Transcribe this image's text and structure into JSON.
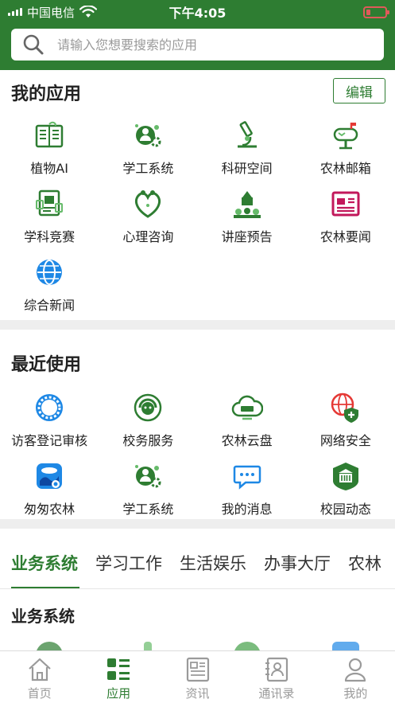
{
  "status_bar": {
    "carrier": "中国电信",
    "time": "下午4:05"
  },
  "search": {
    "placeholder": "请输入您想要搜索的应用"
  },
  "my_apps": {
    "title": "我的应用",
    "edit_label": "编辑",
    "items": [
      {
        "label": "植物AI",
        "icon": "plant-book-icon"
      },
      {
        "label": "学工系统",
        "icon": "student-gear-icon"
      },
      {
        "label": "科研空间",
        "icon": "microscope-icon"
      },
      {
        "label": "农林邮箱",
        "icon": "mailbox-icon"
      },
      {
        "label": "学科竞赛",
        "icon": "competition-icon"
      },
      {
        "label": "心理咨询",
        "icon": "heart-people-icon"
      },
      {
        "label": "讲座预告",
        "icon": "lecture-icon"
      },
      {
        "label": "农林要闻",
        "icon": "newspaper-icon"
      },
      {
        "label": "综合新闻",
        "icon": "globe-icon"
      }
    ]
  },
  "recent": {
    "title": "最近使用",
    "items": [
      {
        "label": "访客登记审核",
        "icon": "visitor-flower-icon"
      },
      {
        "label": "校务服务",
        "icon": "service-headset-icon"
      },
      {
        "label": "农林云盘",
        "icon": "cloud-drive-icon"
      },
      {
        "label": "网络安全",
        "icon": "network-shield-icon"
      },
      {
        "label": "匆匆农林",
        "icon": "photo-app-icon"
      },
      {
        "label": "学工系统",
        "icon": "student-gear-icon"
      },
      {
        "label": "我的消息",
        "icon": "message-icon"
      },
      {
        "label": "校园动态",
        "icon": "campus-building-icon"
      }
    ]
  },
  "tabs": [
    "业务系统",
    "学习工作",
    "生活娱乐",
    "办事大厅",
    "农林"
  ],
  "subsection_title": "业务系统",
  "bottom_nav": [
    {
      "label": "首页",
      "icon": "home-icon"
    },
    {
      "label": "应用",
      "icon": "apps-icon"
    },
    {
      "label": "资讯",
      "icon": "news-icon"
    },
    {
      "label": "通讯录",
      "icon": "contacts-icon"
    },
    {
      "label": "我的",
      "icon": "profile-icon"
    }
  ],
  "colors": {
    "primary": "#2e7d32",
    "accent_pink": "#c2185b",
    "accent_blue": "#1e88e5",
    "accent_red": "#e53935"
  }
}
